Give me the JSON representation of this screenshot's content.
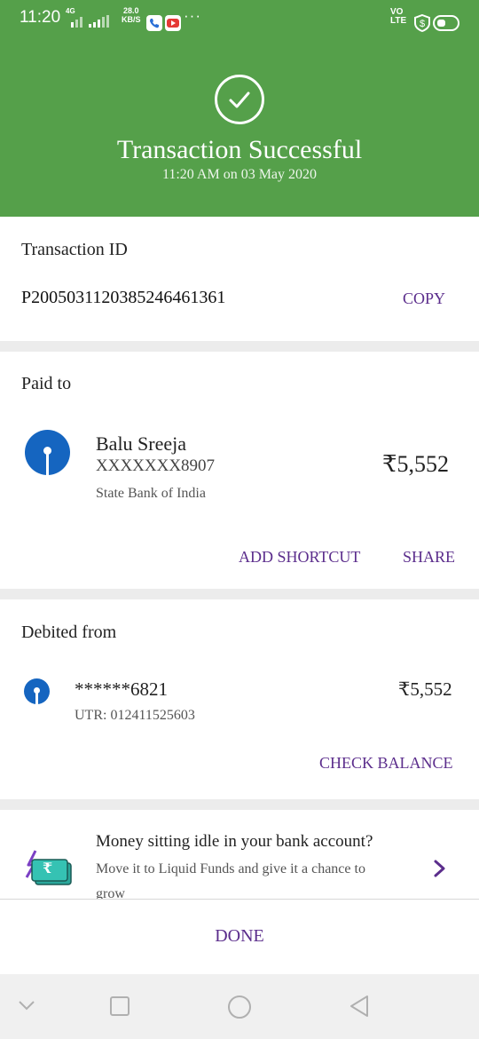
{
  "status_bar": {
    "time": "11:20",
    "network": "4G",
    "speed_value": "28.0",
    "speed_unit": "KB/S",
    "more": "···",
    "volte_top": "VO",
    "volte_bottom": "LTE"
  },
  "header": {
    "title": "Transaction Successful",
    "timestamp": "11:20 AM on 03 May 2020",
    "accent_color": "#55a04a"
  },
  "transaction": {
    "label": "Transaction ID",
    "id": "P2005031120385246461361",
    "copy_label": "COPY"
  },
  "paid_to": {
    "label": "Paid to",
    "name": "Balu Sreeja",
    "account": "XXXXXXX8907",
    "amount": "₹5,552",
    "bank": "State Bank of India",
    "add_shortcut_label": "ADD SHORTCUT",
    "share_label": "SHARE"
  },
  "debited_from": {
    "label": "Debited from",
    "account": "******6821",
    "amount": "₹5,552",
    "utr": "UTR: 012411525603",
    "check_balance_label": "CHECK BALANCE"
  },
  "promo": {
    "title": "Money sitting idle in your bank account?",
    "body_line1": "Move it to Liquid Funds and give it a chance to",
    "body_line2": "grow",
    "icon_symbol": "₹"
  },
  "footer": {
    "done_label": "DONE"
  },
  "nav": {
    "icons": [
      "chevron-down-icon",
      "recents-icon",
      "home-icon",
      "back-icon"
    ]
  }
}
